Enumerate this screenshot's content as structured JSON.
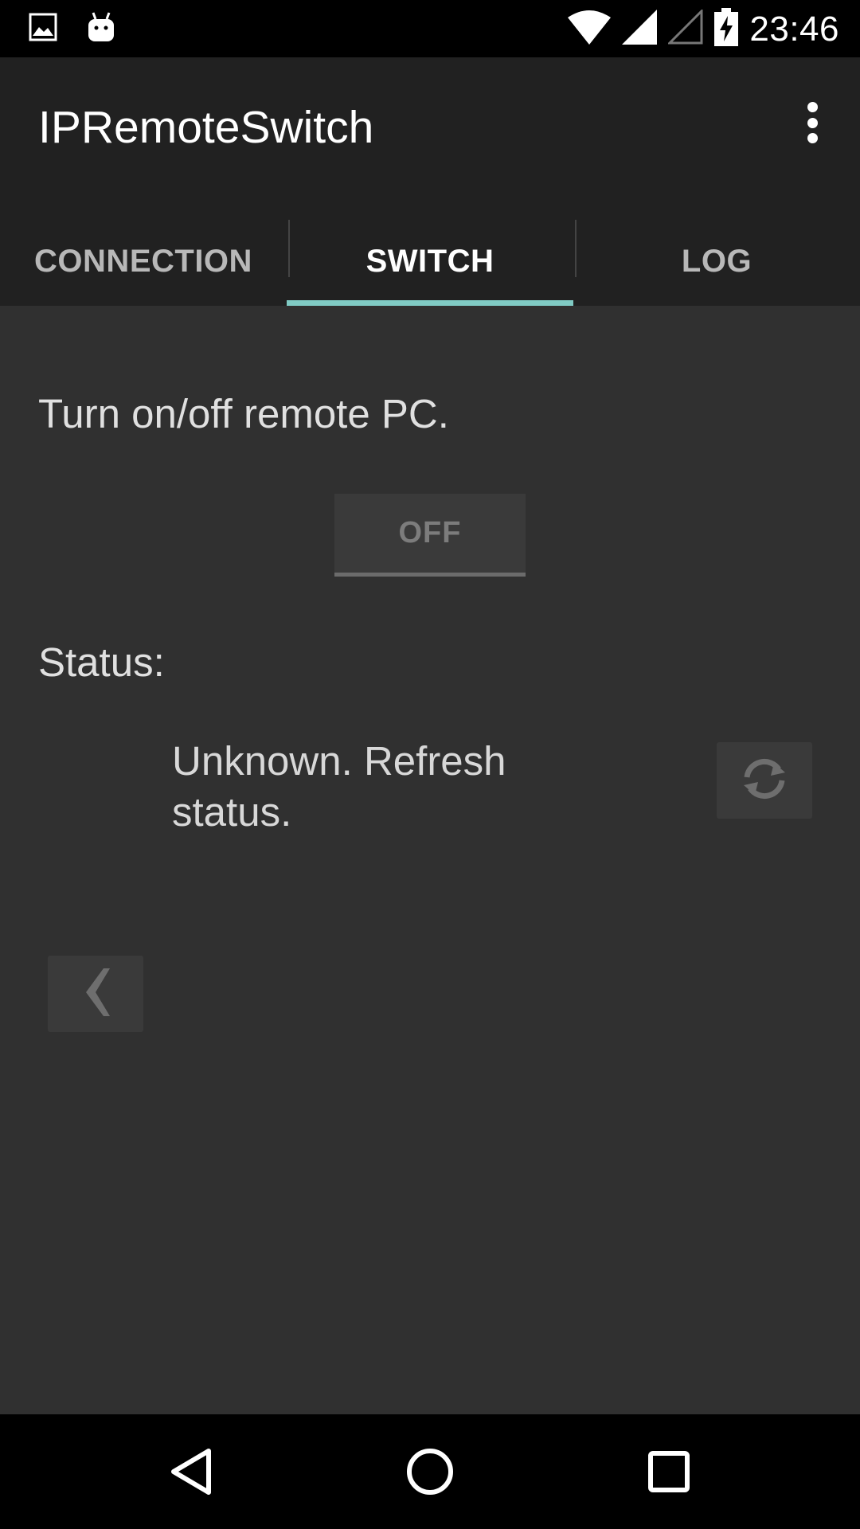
{
  "status_bar": {
    "time": "23:46",
    "icons": [
      "image-icon",
      "android-icon",
      "wifi-icon",
      "signal-icon",
      "signal-empty-icon",
      "battery-charging-icon"
    ]
  },
  "app_bar": {
    "title": "IPRemoteSwitch",
    "menu_icon": "overflow-menu-icon"
  },
  "tabs": [
    {
      "label": "CONNECTION",
      "active": false
    },
    {
      "label": "SWITCH",
      "active": true
    },
    {
      "label": "LOG",
      "active": false
    }
  ],
  "colors": {
    "tab_indicator": "#80cbc4",
    "app_bar_bg": "#212121",
    "content_bg": "#303030"
  },
  "switch": {
    "instruction": "Turn on/off remote PC.",
    "toggle_label": "OFF",
    "status_label": "Status:",
    "status_text": "Unknown. Refresh status.",
    "refresh_icon": "refresh-icon",
    "back_icon": "chevron-left-icon"
  },
  "nav_bar": {
    "icons": [
      "back-triangle-icon",
      "home-circle-icon",
      "recents-square-icon"
    ]
  }
}
